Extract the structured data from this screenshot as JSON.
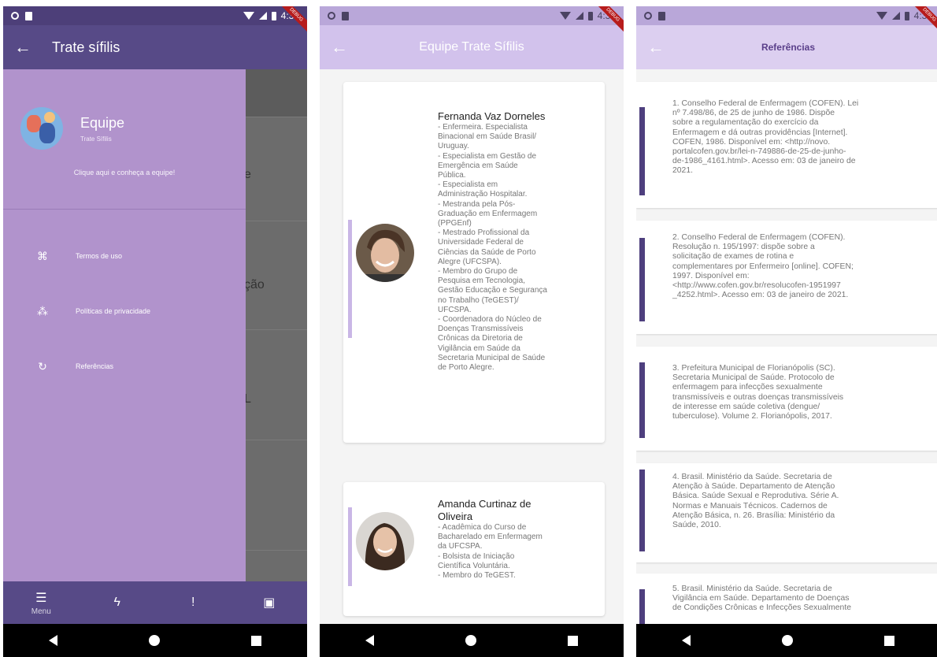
{
  "colors": {
    "primary": "#574a87",
    "drawer": "#b193cc",
    "accent": "#4e3f7e"
  },
  "phone1": {
    "status": {
      "time": "4:33"
    },
    "debug_ribbon": "DEBUG",
    "appbar": {
      "title": "Trate sífilis"
    },
    "drawer": {
      "title": "Equipe",
      "subtitle": "Trate Sífilis",
      "link": "Clique aqui e conheça a equipe!",
      "items": [
        {
          "icon": "document-icon",
          "label": "Termos de uso"
        },
        {
          "icon": "share-icon",
          "label": "Políticas de privacidade"
        },
        {
          "icon": "refresh-icon",
          "label": "Referências"
        }
      ]
    },
    "behind_fragments": [
      "e",
      "ção",
      "L"
    ],
    "bottom_nav": {
      "menu_label": "Menu"
    }
  },
  "phone2": {
    "status": {
      "time": "4:34"
    },
    "appbar": {
      "title": "Equipe Trate Sífilis"
    },
    "members": [
      {
        "name": "Fernanda Vaz Dorneles",
        "lines": [
          " - Enfermeira. Especialista",
          "Binacional em Saúde Brasil/",
          "Uruguay.",
          " - Especialista em Gestão de",
          "Emergência em Saúde",
          "Pública.",
          " - Especialista em",
          "Administração Hospitalar.",
          " - Mestranda pela Pós-",
          "Graduação em Enfermagem",
          "(PPGEnf)",
          " - Mestrado Profissional da",
          "Universidade Federal de",
          "Ciências da Saúde de Porto",
          "Alegre (UFCSPA).",
          " - Membro do Grupo de",
          "Pesquisa em Tecnologia,",
          "Gestão Educação e Segurança",
          "no Trabalho (TeGEST)/",
          "UFCSPA.",
          " - Coordenadora do Núcleo de",
          "Doenças Transmissíveis",
          "Crônicas da Diretoria de",
          "Vigilância em Saúde da",
          "Secretaria Municipal de Saúde",
          "de Porto Alegre."
        ]
      },
      {
        "name_lines": [
          "Amanda Curtinaz de",
          "Oliveira"
        ],
        "lines": [
          " - Acadêmica do Curso de",
          "Bacharelado em Enfermagem",
          "da UFCSPA.",
          " - Bolsista de Iniciação",
          "Científica Voluntária.",
          " - Membro do TeGEST."
        ]
      }
    ]
  },
  "phone3": {
    "status": {
      "time": "4:34"
    },
    "appbar": {
      "title": "Referências"
    },
    "references": [
      [
        "1. Conselho Federal de Enfermagem (COFEN). Lei",
        "nº 7.498/86, de 25 de junho de 1986. Dispõe",
        "sobre a regulamentação do exercício da",
        "Enfermagem e dá outras providências [Internet].",
        "COFEN, 1986. Disponível em: <http://novo.",
        "portalcofen.gov.br/lei-n-749886-de-25-de-junho-",
        "de-1986_4161.html>. Acesso em: 03 de janeiro de",
        "2021."
      ],
      [
        "2. Conselho Federal de Enfermagem (COFEN).",
        "Resolução n. 195/1997: dispõe sobre a",
        "solicitação de exames de rotina e",
        "complementares por Enfermeiro [online]. COFEN;",
        "1997. Disponível em:",
        "<http://www.cofen.gov.br/resolucofen-1951997",
        "_4252.html>. Acesso em: 03 de janeiro de 2021."
      ],
      [
        "3. Prefeitura Municipal de Florianópolis (SC).",
        "Secretaria Municipal de Saúde. Protocolo de",
        "enfermagem para infecções sexualmente",
        "transmissíveis e outras doenças transmissíveis",
        "de interesse em saúde coletiva (dengue/",
        "tuberculose). Volume 2. Florianópolis, 2017."
      ],
      [
        "4. Brasil. Ministério da Saúde. Secretaria de",
        "Atenção à Saúde. Departamento de Atenção",
        "Básica. Saúde Sexual e Reprodutiva. Série A.",
        "Normas e Manuais Técnicos. Cadernos de",
        "Atenção Básica, n. 26. Brasília: Ministério da",
        "Saúde, 2010."
      ],
      [
        "5. Brasil. Ministério da Saúde. Secretaria de",
        "Vigilância em Saúde. Departamento de Doenças",
        "de Condições Crônicas e Infecções Sexualmente"
      ]
    ]
  }
}
